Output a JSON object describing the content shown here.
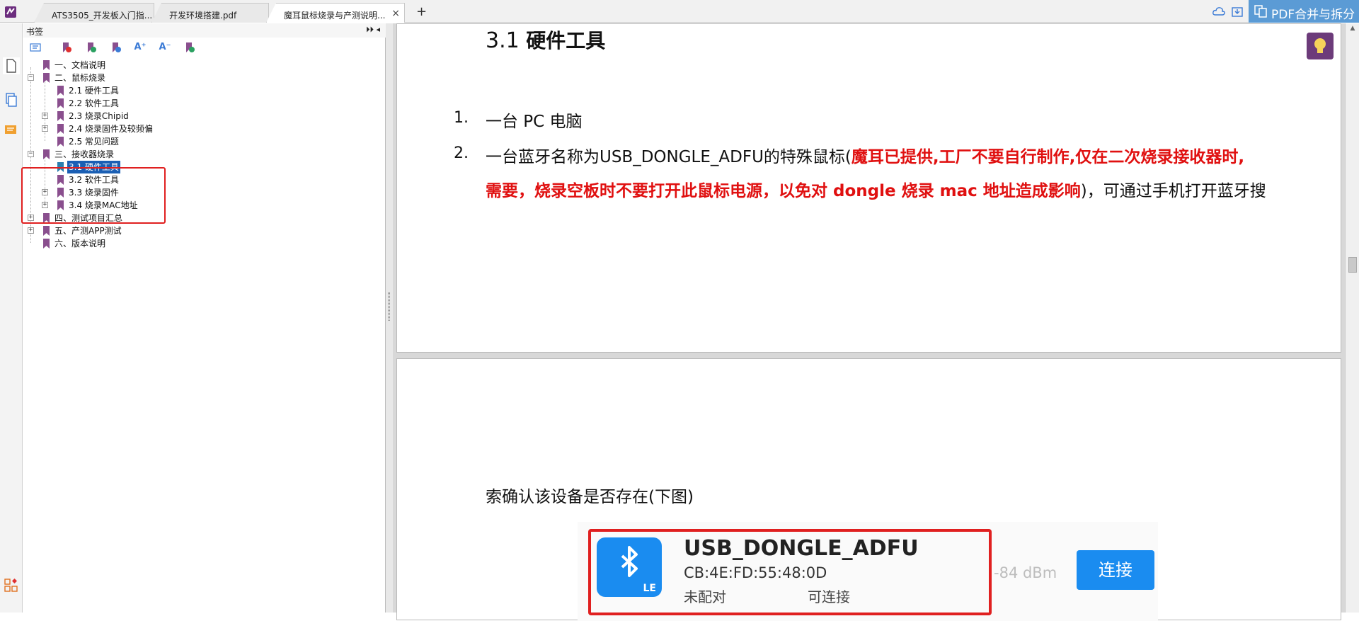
{
  "tabs": [
    {
      "label": "ATS3505_开发板入门指..."
    },
    {
      "label": "开发环境搭建.pdf"
    },
    {
      "label": "魔耳鼠标烧录与产测说明...",
      "close": "×"
    }
  ],
  "new_tab": "+",
  "pdf_merge_label": "PDF合并与拆分",
  "bookmarks": {
    "title": "书签",
    "header_ctrls": "⏵⏵ ◂",
    "items": [
      {
        "label": "一、文档说明"
      },
      {
        "label": "二、鼠标烧录",
        "expander": "−"
      },
      {
        "label": "2.1 硬件工具"
      },
      {
        "label": "2.2 软件工具"
      },
      {
        "label": "2.3 烧录Chipid",
        "expander": "+"
      },
      {
        "label": "2.4 烧录固件及较频偏",
        "expander": "+"
      },
      {
        "label": "2.5 常见问题"
      },
      {
        "label": "三、接收器烧录",
        "expander": "−"
      },
      {
        "label": "3.1 硬件工具"
      },
      {
        "label": "3.2 软件工具"
      },
      {
        "label": "3.3 烧录固件",
        "expander": "+"
      },
      {
        "label": "3.4 烧录MAC地址",
        "expander": "+"
      },
      {
        "label": "四、测试项目汇总",
        "expander": "+"
      },
      {
        "label": "五、产测APP测试",
        "expander": "+"
      },
      {
        "label": "六、版本说明"
      }
    ],
    "selected_index": 8
  },
  "doc": {
    "heading_num": "3.1",
    "heading_text": "硬件工具",
    "list": [
      {
        "num": "1.",
        "text": "一台 PC 电脑"
      },
      {
        "num": "2.",
        "text_a": "一台蓝牙名称为USB_DONGLE_ADFU的特殊鼠标(",
        "red_a": "魔耳已提供,工厂不要自行制作,仅在二次烧录接收器时,",
        "red_b": "需要，烧录空板时不要打开此鼠标电源，以免对 dongle 烧录 mac 地址造成影响",
        "text_b": ")，可通过手机打开蓝牙搜"
      }
    ],
    "confirm_text": "索确认该设备是否存在(下图)",
    "device": {
      "name": "USB_DONGLE_ADFU",
      "mac": "CB:4E:FD:55:48:0D",
      "status": "未配对",
      "connectable": "可连接",
      "rssi": "-84 dBm",
      "connect_label": "连接",
      "le_badge": "LE"
    }
  },
  "colors": {
    "accent": "#5b9bd5",
    "bookmark": "#8a4f8e",
    "selection": "#1a5fb4",
    "highlight_red": "#e02020",
    "bt_blue": "#1a8cf0"
  }
}
